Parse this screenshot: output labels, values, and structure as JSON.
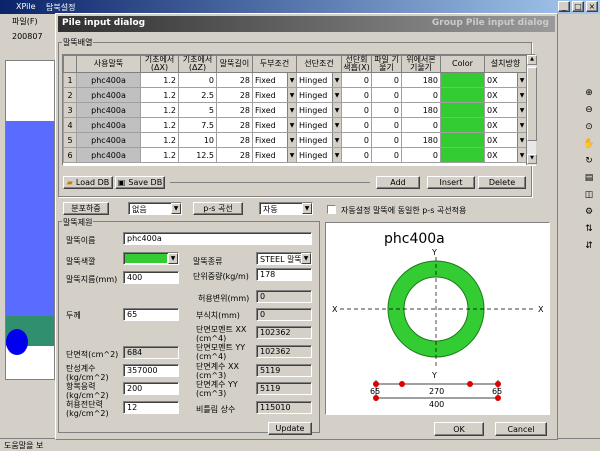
{
  "app": {
    "title": "XPile",
    "tab_title": "탑북설정",
    "menu_item": "파일(F)",
    "toolbar_text": "200807",
    "status_text": "도움말을 보"
  },
  "dialog": {
    "title": "Pile input dialog",
    "header_right": "Group Pile input dialog"
  },
  "pile_db": {
    "group_label": "말뚝배열",
    "columns": [
      "사용말뚝",
      "기초에서 (ΔX)",
      "기초에서 (ΔZ)",
      "말뚝길이",
      "두부조건",
      "선단조건",
      "선단회 색흡(X)",
      "파일 기울기",
      "위에서본 기울기",
      "Color",
      "설치방향"
    ],
    "rows": [
      {
        "no": "1",
        "pile": "phc400a",
        "dx": "1.2",
        "dz": "0",
        "length": "28",
        "head": "Fixed",
        "tip": "Hinged",
        "tip_x": "0",
        "slope": "0",
        "top_slope": "180",
        "orient": "0X"
      },
      {
        "no": "2",
        "pile": "phc400a",
        "dx": "1.2",
        "dz": "2.5",
        "length": "28",
        "head": "Fixed",
        "tip": "Hinged",
        "tip_x": "0",
        "slope": "0",
        "top_slope": "0",
        "orient": "0X"
      },
      {
        "no": "3",
        "pile": "phc400a",
        "dx": "1.2",
        "dz": "5",
        "length": "28",
        "head": "Fixed",
        "tip": "Hinged",
        "tip_x": "0",
        "slope": "0",
        "top_slope": "180",
        "orient": "0X"
      },
      {
        "no": "4",
        "pile": "phc400a",
        "dx": "1.2",
        "dz": "7.5",
        "length": "28",
        "head": "Fixed",
        "tip": "Hinged",
        "tip_x": "0",
        "slope": "0",
        "top_slope": "0",
        "orient": "0X"
      },
      {
        "no": "5",
        "pile": "phc400a",
        "dx": "1.2",
        "dz": "10",
        "length": "28",
        "head": "Fixed",
        "tip": "Hinged",
        "tip_x": "0",
        "slope": "0",
        "top_slope": "180",
        "orient": "0X"
      },
      {
        "no": "6",
        "pile": "phc400a",
        "dx": "1.2",
        "dz": "12.5",
        "length": "28",
        "head": "Fixed",
        "tip": "Hinged",
        "tip_x": "0",
        "slope": "0",
        "top_slope": "0",
        "orient": "0X"
      }
    ],
    "load_db": "Load DB",
    "save_db": "Save DB",
    "add": "Add",
    "insert": "Insert",
    "delete": "Delete"
  },
  "options": {
    "distribution_label": "분포하중",
    "distribution_value": "없음",
    "py_curve_button": "p-s 곡선",
    "py_curve_value": "자동",
    "auto_check_label": "자동설정 말뚝에 동일한 p-s 곡선적용"
  },
  "properties": {
    "group_label": "말뚝제원",
    "name_label": "말뚝이름",
    "name_value": "phc400a",
    "color_label": "말뚝색깔",
    "color_value": "#33cc33",
    "type_label": "말뚝종류",
    "type_value": "STEEL 말뚝",
    "diameter_label": "말뚝지름(mm)",
    "diameter_value": "400",
    "unit_weight_label": "단위중량(kg/m)",
    "unit_weight_value": "178",
    "allow_label": "허용변위(mm)",
    "allow_value": "0",
    "thickness_label": "두께",
    "thickness_value": "65",
    "corrosion_label": "부식치(mm)",
    "corrosion_value": "0",
    "area_label": "단면적(cm^2)",
    "area_value": "684",
    "ix_label": "단면모멘트 XX (cm^4)",
    "ix_value": "102362",
    "iy_label": "단면모멘트 YY (cm^4)",
    "iy_value": "102362",
    "elastic_label": "탄성계수 (kg/cm^2)",
    "elastic_value": "357000",
    "zx_label": "단면계수 XX (cm^3)",
    "zx_value": "5119",
    "yield_label": "항복응력 (kg/cm^2)",
    "yield_value": "200",
    "zy_label": "단면계수 YY (cm^3)",
    "zy_value": "5119",
    "shear_label": "허용전단력 (kg/cm^2)",
    "shear_value": "12",
    "ratio_label": "비틀림 상수",
    "ratio_value": "115010",
    "update": "Update"
  },
  "preview": {
    "title": "phc400a",
    "axis_y": "Y",
    "axis_x": "X",
    "dim_inner": "270",
    "dim_outer": "400",
    "dim_left": "65",
    "dim_right": "65",
    "ring_color": "#33cc33"
  },
  "buttons": {
    "ok": "OK",
    "cancel": "Cancel"
  }
}
